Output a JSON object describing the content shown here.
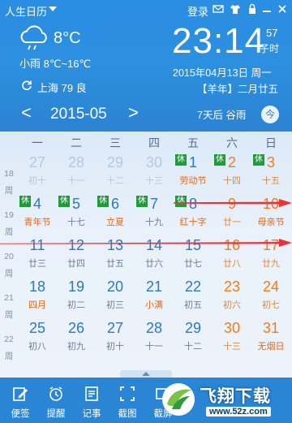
{
  "titlebar": {
    "app_title": "人生日历",
    "login_label": "登录"
  },
  "weather": {
    "temp_now": "8°C",
    "description": "小雨 8℃~16℃",
    "location": "上海 79 良"
  },
  "clock": {
    "time": "23:14",
    "seconds": "57",
    "shichen": "子时",
    "gregorian": "2015年04月13日 周一",
    "lunar": "【羊年】二月廿五"
  },
  "nav": {
    "prev": "<",
    "month": "2015-05",
    "next": ">",
    "festival_hint": "7天后 谷雨",
    "today_label": "今"
  },
  "weekdays": [
    "一",
    "二",
    "三",
    "四",
    "五",
    "六",
    "日"
  ],
  "week_label": "周",
  "weeks": [
    {
      "num": "18",
      "days": [
        {
          "d": "27",
          "s": "初十",
          "other": true
        },
        {
          "d": "28",
          "s": "十一",
          "other": true
        },
        {
          "d": "29",
          "s": "十二",
          "other": true
        },
        {
          "d": "30",
          "s": "十三",
          "other": true
        },
        {
          "d": "1",
          "s": "劳动节",
          "rest": true,
          "fest": true
        },
        {
          "d": "2",
          "s": "十四",
          "rest": true,
          "weekend": true
        },
        {
          "d": "3",
          "s": "十五",
          "rest": true,
          "weekend": true
        }
      ]
    },
    {
      "num": "19",
      "days": [
        {
          "d": "4",
          "s": "青年节",
          "rest": true,
          "fest": true
        },
        {
          "d": "5",
          "s": "十七",
          "rest": true
        },
        {
          "d": "6",
          "s": "立夏",
          "rest": true,
          "fest": true
        },
        {
          "d": "7",
          "s": "十九",
          "rest": true
        },
        {
          "d": "8",
          "s": "红十字",
          "rest": true,
          "fest": true
        },
        {
          "d": "9",
          "s": "廿一",
          "weekend": true
        },
        {
          "d": "10",
          "s": "母亲节",
          "weekend": true,
          "fest": true
        }
      ]
    },
    {
      "num": "20",
      "days": [
        {
          "d": "11",
          "s": "廿三"
        },
        {
          "d": "12",
          "s": "廿四"
        },
        {
          "d": "13",
          "s": "廿五"
        },
        {
          "d": "14",
          "s": "廿六"
        },
        {
          "d": "15",
          "s": "廿七"
        },
        {
          "d": "16",
          "s": "廿八",
          "weekend": true
        },
        {
          "d": "17",
          "s": "廿九",
          "weekend": true
        }
      ]
    },
    {
      "num": "21",
      "days": [
        {
          "d": "18",
          "s": "四月",
          "fest": true
        },
        {
          "d": "19",
          "s": "初二"
        },
        {
          "d": "20",
          "s": "初三"
        },
        {
          "d": "21",
          "s": "小满",
          "fest": true
        },
        {
          "d": "22",
          "s": "初五"
        },
        {
          "d": "23",
          "s": "初六",
          "weekend": true
        },
        {
          "d": "24",
          "s": "初七",
          "weekend": true
        }
      ]
    },
    {
      "num": "22",
      "days": [
        {
          "d": "25",
          "s": "初八"
        },
        {
          "d": "26",
          "s": "初九"
        },
        {
          "d": "27",
          "s": "初十"
        },
        {
          "d": "28",
          "s": "十一"
        },
        {
          "d": "29",
          "s": "十二"
        },
        {
          "d": "30",
          "s": "十三",
          "weekend": true
        },
        {
          "d": "31",
          "s": "无烟日",
          "weekend": true,
          "fest": true
        }
      ]
    }
  ],
  "rest_badge": "休",
  "toolbar": [
    {
      "label": "便签",
      "icon": "edit-icon"
    },
    {
      "label": "提醒",
      "icon": "alarm-icon"
    },
    {
      "label": "记事",
      "icon": "note-icon"
    },
    {
      "label": "截图",
      "icon": "screenshot-icon"
    },
    {
      "label": "截屏",
      "icon": "more-icon"
    }
  ],
  "watermark": {
    "title": "飞翔下载",
    "url": "www.52z.com"
  },
  "colors": {
    "top_bg": "#2d8fdf",
    "weekend": "#f07d19",
    "rest_badge": "#1f9b38",
    "arrow": "#e8333a"
  }
}
